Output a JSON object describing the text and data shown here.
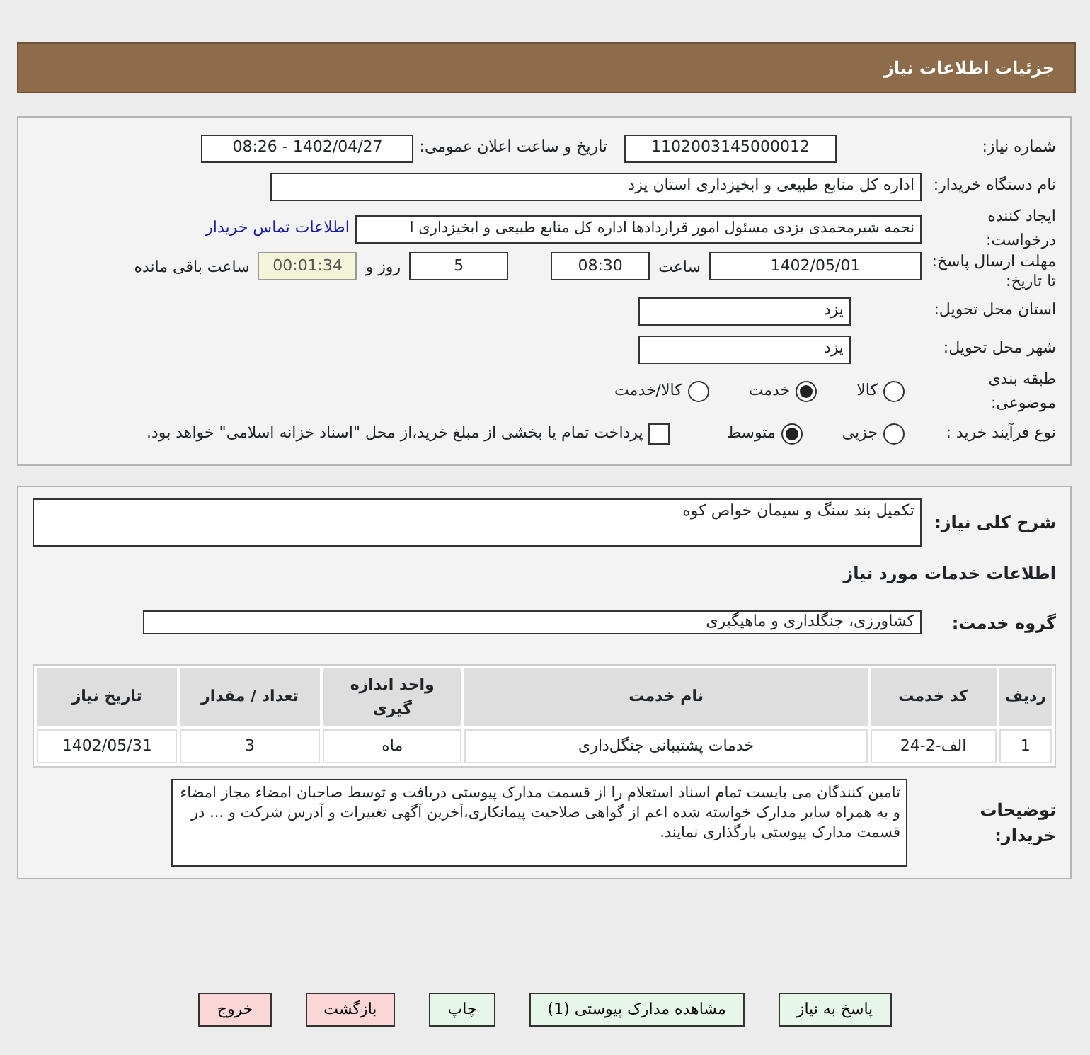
{
  "title": "جزئیات اطلاعات نیاز",
  "need_number": {
    "label": "شماره نیاز:",
    "value": "1102003145000012"
  },
  "announce_datetime": {
    "label": "تاریخ و ساعت اعلان عمومی:",
    "value": "1402/04/27 - 08:26"
  },
  "buyer_org": {
    "label": "نام دستگاه خریدار:",
    "value": "اداره کل منابع طبیعی و ابخیزداری استان یزد"
  },
  "requester": {
    "label": "ایجاد کننده درخواست:",
    "value": "نجمه شیرمحمدی یزدی مسئول امور قراردادها اداره کل منابع طبیعی و ابخیزداری ا",
    "link": "اطلاعات تماس خریدار"
  },
  "deadline": {
    "label": "مهلت ارسال پاسخ: تا تاریخ:",
    "date": "1402/05/01",
    "time_label": "ساعت",
    "time": "08:30",
    "days": "5",
    "days_label": "روز و",
    "remaining": "00:01:34",
    "remaining_label": "ساعت باقی مانده"
  },
  "province": {
    "label": "استان محل تحویل:",
    "value": "یزد"
  },
  "city": {
    "label": "شهر محل تحویل:",
    "value": "یزد"
  },
  "category": {
    "label": "طبقه بندی موضوعی:",
    "options": [
      {
        "label": "کالا",
        "selected": false
      },
      {
        "label": "خدمت",
        "selected": true
      },
      {
        "label": "کالا/خدمت",
        "selected": false
      }
    ]
  },
  "process": {
    "label": "نوع فرآیند خرید :",
    "options": [
      {
        "label": "جزیی",
        "selected": false
      },
      {
        "label": "متوسط",
        "selected": true
      }
    ],
    "payment": {
      "label": "پرداخت تمام یا بخشی از مبلغ خرید،از محل \"اسناد خزانه اسلامی\" خواهد بود.",
      "checked": false
    }
  },
  "summary": {
    "label": "شرح کلی نیاز:",
    "value": "تکمیل بند سنگ و سیمان خواص کوه"
  },
  "services_heading": "اطلاعات خدمات مورد نیاز",
  "service_group": {
    "label": "گروه خدمت:",
    "value": "کشاورزی، جنگلداری و ماهیگیری"
  },
  "table": {
    "columns": [
      "ردیف",
      "کد خدمت",
      "نام خدمت",
      "واحد اندازه گیری",
      "تعداد / مقدار",
      "تاریخ نیاز"
    ],
    "rows": [
      [
        "1",
        "الف-2-24",
        "خدمات پشتیبانی جنگل‌داری",
        "ماه",
        "3",
        "1402/05/31"
      ]
    ]
  },
  "buyer_notes": {
    "label": "توضیحات خریدار:",
    "value": "تامین کنندگان می بایست تمام اسناد استعلام را از قسمت مدارک پیوستی دریافت و توسط صاحبان امضاء مجاز امضاء و به همراه سایر مدارک خواسته شده اعم از گواهی صلاحیت پیمانکاری،آخرین آگهی تغییرات و آدرس شرکت و ... در قسمت مدارک پیوستی بارگذاری نمایند."
  },
  "buttons": [
    {
      "label": "پاسخ به نیاز",
      "kind": "normal"
    },
    {
      "label": "مشاهده مدارک پیوستی (1)",
      "kind": "normal"
    },
    {
      "label": "چاپ",
      "kind": "normal"
    },
    {
      "label": "بازگشت",
      "kind": "danger"
    },
    {
      "label": "خروج",
      "kind": "danger"
    }
  ]
}
